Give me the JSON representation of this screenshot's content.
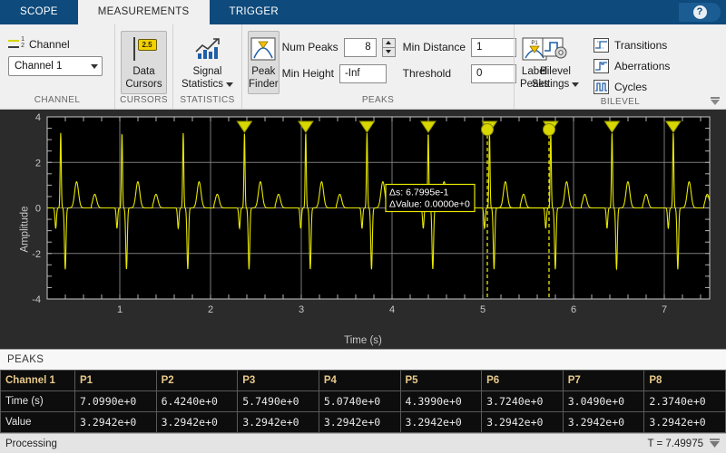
{
  "tabs": [
    {
      "label": "SCOPE",
      "active": false
    },
    {
      "label": "MEASUREMENTS",
      "active": true
    },
    {
      "label": "TRIGGER",
      "active": false
    }
  ],
  "help": {
    "glyph": "?"
  },
  "ribbon": {
    "channel": {
      "title": "CHANNEL",
      "label": "Channel",
      "icon_top": "1",
      "icon_bottom": "2",
      "select_value": "Channel 1"
    },
    "cursors": {
      "title": "CURSORS",
      "button_line1": "Data",
      "button_line2": "Cursors",
      "badge": "2.5",
      "active": true
    },
    "statistics": {
      "title": "STATISTICS",
      "button_line1": "Signal",
      "button_line2": "Statistics"
    },
    "peaks": {
      "title": "PEAKS",
      "peak_finder_line1": "Peak",
      "peak_finder_line2": "Finder",
      "peak_finder_active": true,
      "fields": [
        {
          "label": "Num Peaks",
          "value": "8",
          "spinner": true
        },
        {
          "label": "Min Distance",
          "value": "1",
          "spinner": false
        },
        {
          "label": "Min Height",
          "value": "-Inf",
          "spinner": false
        },
        {
          "label": "Threshold",
          "value": "0",
          "spinner": false
        }
      ],
      "label_peaks_line1": "Label",
      "label_peaks_line2": "Peaks",
      "label_peaks_badge": "P1"
    },
    "bilevel": {
      "title": "BILEVEL",
      "settings_line1": "Bilevel",
      "settings_line2": "Settings",
      "items": [
        {
          "label": "Transitions"
        },
        {
          "label": "Aberrations"
        },
        {
          "label": "Cycles"
        }
      ]
    }
  },
  "plot": {
    "ylabel": "Amplitude",
    "xlabel": "Time (s)",
    "ylim": [
      -4,
      4
    ],
    "yticks": [
      -4,
      -2,
      0,
      2,
      4
    ],
    "xlim": [
      0.2,
      7.5
    ],
    "xticks": [
      1,
      2,
      3,
      4,
      5,
      6,
      7
    ],
    "trace_color": "#e8e800",
    "bg_color": "#000000",
    "tooltip": {
      "line1": "Δs: 6.7995e-1",
      "line2": "ΔValue: 0.0000e+0"
    },
    "cursors": {
      "t1": 5.05,
      "t2": 5.73,
      "value": 0.0
    },
    "peak_markers": [
      2.374,
      3.049,
      3.724,
      4.399,
      5.074,
      5.749,
      6.424,
      7.099
    ],
    "peak_value": 3.2942
  },
  "chart_data": {
    "type": "line",
    "title": "",
    "xlabel": "Time (s)",
    "ylabel": "Amplitude",
    "xlim": [
      0.2,
      7.5
    ],
    "ylim": [
      -4,
      4
    ],
    "xticks": [
      1,
      2,
      3,
      4,
      5,
      6,
      7
    ],
    "yticks": [
      -4,
      -2,
      0,
      2,
      4
    ],
    "grid": true,
    "legend": "none",
    "series": [
      {
        "name": "Channel 1",
        "color": "#e8e800",
        "description": "Periodic ECG-like waveform, period 0.675 s, baseline 0, P-wave ~+0.6, QRS peak ~+3.29 with Q ~-0.9 and S ~-2.7, T-wave ~+1.15",
        "period": 0.675,
        "baseline": 0.0,
        "peak_amplitude": 3.2942
      }
    ],
    "markers": {
      "name": "Peaks",
      "x": [
        2.374,
        3.049,
        3.724,
        4.399,
        5.074,
        5.749,
        6.424,
        7.099
      ],
      "y": [
        3.2942,
        3.2942,
        3.2942,
        3.2942,
        3.2942,
        3.2942,
        3.2942,
        3.2942
      ]
    },
    "annotations": [
      {
        "text": "Δs: 6.7995e-1",
        "x": 4.6,
        "y": 1.2
      },
      {
        "text": "ΔValue: 0.0000e+0",
        "x": 4.6,
        "y": 0.7
      }
    ]
  },
  "peaks_panel": {
    "title": "PEAKS",
    "columns": [
      "Channel 1",
      "P1",
      "P2",
      "P3",
      "P4",
      "P5",
      "P6",
      "P7",
      "P8"
    ],
    "rows": [
      {
        "label": "Time (s)",
        "values": [
          "7.0990e+0",
          "6.4240e+0",
          "5.7490e+0",
          "5.0740e+0",
          "4.3990e+0",
          "3.7240e+0",
          "3.0490e+0",
          "2.3740e+0"
        ]
      },
      {
        "label": "Value",
        "values": [
          "3.2942e+0",
          "3.2942e+0",
          "3.2942e+0",
          "3.2942e+0",
          "3.2942e+0",
          "3.2942e+0",
          "3.2942e+0",
          "3.2942e+0"
        ]
      }
    ]
  },
  "status": {
    "message": "Processing",
    "time": "T = 7.49975"
  }
}
